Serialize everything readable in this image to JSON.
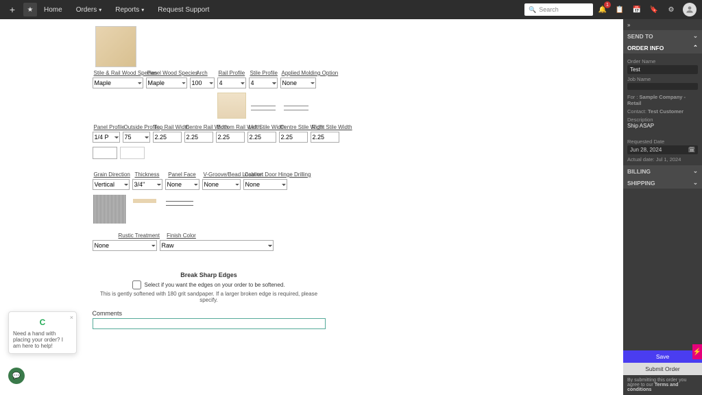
{
  "topbar": {
    "plus": "+",
    "star": "★",
    "home": "Home",
    "orders": "Orders",
    "reports": "Reports",
    "request_support": "Request Support",
    "search_placeholder": "Search",
    "notif_count": "1"
  },
  "row1": {
    "stile_rail_species": {
      "label": "Stile & Rail Wood Species",
      "value": "Maple"
    },
    "panel_species": {
      "label": "Panel Wood Species",
      "value": "Maple"
    },
    "arch": {
      "label": "Arch",
      "value": "100"
    },
    "rail_profile": {
      "label": "Rail Profile",
      "value": "4"
    },
    "stile_profile": {
      "label": "Stile Profile",
      "value": "4"
    },
    "applied_molding": {
      "label": "Applied Molding Option",
      "value": "None"
    }
  },
  "row2": {
    "panel_profile": {
      "label": "Panel Profile",
      "value": "1/4 P"
    },
    "outside_profile": {
      "label": "Outside Profile",
      "value": "75"
    },
    "top_rail": {
      "label": "Top Rail Width",
      "value": "2.25"
    },
    "centre_rail": {
      "label": "Centre Rail Width",
      "value": "2.25"
    },
    "bottom_rail": {
      "label": "Bottom Rail Width",
      "value": "2.25"
    },
    "left_stile": {
      "label": "Left Stile Width",
      "value": "2.25"
    },
    "centre_stile": {
      "label": "Centre Stile Width",
      "value": "2.25"
    },
    "right_stile": {
      "label": "Right Stile Width",
      "value": "2.25"
    }
  },
  "row3": {
    "grain": {
      "label": "Grain Direction",
      "value": "Vertical"
    },
    "thickness": {
      "label": "Thickness",
      "value": "3/4\""
    },
    "panel_face": {
      "label": "Panel Face",
      "value": "None"
    },
    "vgroove": {
      "label": "V-Groove/Bead Location",
      "value": "None"
    },
    "hinge": {
      "label": "Cabinet Door Hinge Drilling",
      "value": "None"
    }
  },
  "row4": {
    "rustic": {
      "label": "Rustic Treatment",
      "value": "None"
    },
    "finish_color": {
      "label": "Finish Color",
      "value": "Raw"
    }
  },
  "break_sharp": {
    "title": "Break Sharp Edges",
    "checkbox_label": "Select if you want the edges on your order to be softened.",
    "note": "This is gently softened with 180 grit sandpaper. If a larger broken edge is required, please specify."
  },
  "comments": {
    "label": "Comments",
    "value": ""
  },
  "rpanel": {
    "send_to": "SEND TO",
    "order_info": "ORDER INFO",
    "order_name_lbl": "Order Name",
    "order_name": "Test",
    "job_name_lbl": "Job Name",
    "for_lbl": "For :",
    "for_val": "Sample Company - Retail",
    "contact_lbl": "Contact:",
    "contact_val": "Test Customer",
    "desc_lbl": "Description",
    "desc_val": "Ship  ASAP",
    "req_date_lbl": "Requested Date",
    "req_date": "Jun 28, 2024",
    "actual_date_lbl": "Actual date:",
    "actual_date": "Jul 1, 2024",
    "billing": "BILLING",
    "shipping": "SHIPPING",
    "save": "Save",
    "submit": "Submit Order",
    "terms_pre": "By submitting this order you agree to our ",
    "terms_link": "Terms and conditions"
  },
  "help": {
    "text": "Need a hand with placing your order? I am here to help!",
    "logo": "C"
  }
}
